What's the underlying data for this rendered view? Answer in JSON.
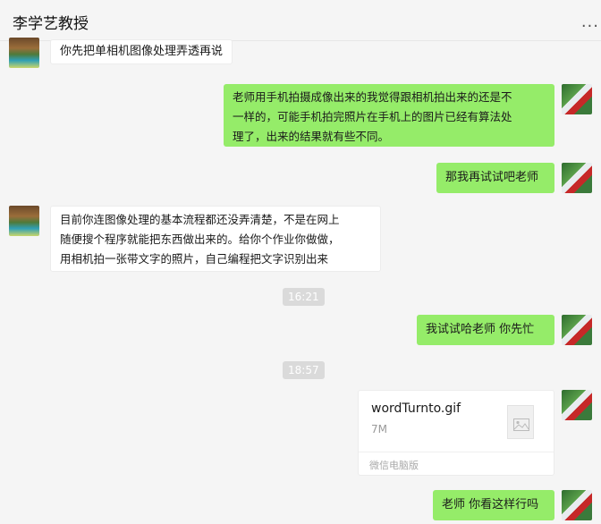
{
  "header": {
    "title": "李学艺教授",
    "more": "..."
  },
  "messages": [
    {
      "lines": [
        "你先把单相机图像处理弄透再说"
      ]
    },
    {
      "lines": [
        "老师用手机拍摄成像出来的我觉得跟相机拍出来的还是不",
        "一样的，可能手机拍完照片在手机上的图片已经有算法处",
        "理了，出来的结果就有些不同。"
      ]
    },
    {
      "lines": [
        "那我再试试吧老师"
      ]
    },
    {
      "lines": [
        "目前你连图像处理的基本流程都还没弄清楚，不是在网上",
        "随便搜个程序就能把东西做出来的。给你个作业你做做，",
        "用相机拍一张带文字的照片，自己编程把文字识别出来"
      ]
    },
    {
      "lines": [
        "我试试哈老师  你先忙"
      ]
    },
    {
      "lines": [
        "老师 你看这样行吗"
      ]
    }
  ],
  "times": [
    "16:21",
    "18:57"
  ],
  "file": {
    "name": "wordTurnto.gif",
    "size": "7M",
    "source": "微信电脑版",
    "icon": "image-file-icon"
  },
  "colors": {
    "outgoing_bubble": "#95ec69",
    "incoming_bubble": "#ffffff",
    "background": "#f5f5f5"
  }
}
